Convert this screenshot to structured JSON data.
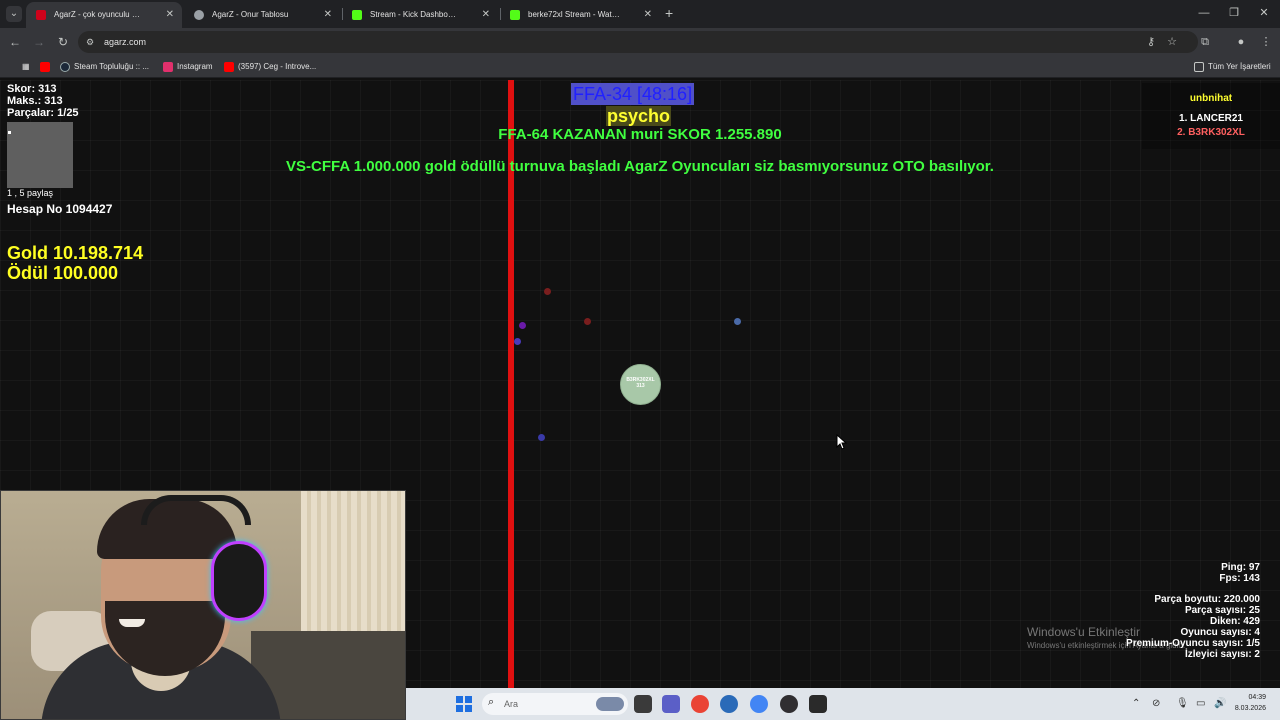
{
  "browser": {
    "tabs": [
      {
        "label": "AgarZ - çok oyunculu tarayıcı o",
        "active": true,
        "favicon_color": "#d0021b"
      },
      {
        "label": "AgarZ - Onur Tablosu",
        "active": false,
        "favicon_color": "#9aa0a6"
      },
      {
        "label": "Stream - Kick Dashboard",
        "active": false,
        "favicon_color": "#53fc18"
      },
      {
        "label": "berke72xl Stream - Watch Live o",
        "active": false,
        "favicon_color": "#53fc18"
      }
    ],
    "new_tab": "+",
    "url": "agarz.com",
    "bookmarks": [
      {
        "label": "Steam Topluluğu :: ...",
        "favicon_color": "#1b2838"
      },
      {
        "label": "Instagram",
        "favicon_color": "#e1306c"
      },
      {
        "label": "(3597) Ceg - Introve...",
        "favicon_color": "#ff0000"
      }
    ],
    "all_bookmarks": "Tüm Yer İşaretleri"
  },
  "game": {
    "stats": {
      "score": "Skor: 313",
      "max": "Maks.: 313",
      "pieces": "Parçalar: 1/25"
    },
    "share": "1 , 5 paylaş",
    "account": "Hesap No 1094427",
    "gold": "Gold 10.198.714",
    "reward": "Ödül 100.000",
    "server": "FFA-34 [48:16]",
    "top_player": "psycho",
    "winner_msg": "FFA-64 KAZANAN muri SKOR 1.255.890",
    "announcement": "VS-CFFA 1.000.000 gold ödüllü turnuva başladı AgarZ Oyuncuları siz basmıyorsunuz OTO basılıyor.",
    "leaderboard": {
      "title": "unbnihat",
      "rows": [
        "1. LANCER21",
        "2. B3RK302XL"
      ]
    },
    "cell": {
      "name": "B3RK302XL",
      "mass": "313",
      "color": "#a8c8a8"
    },
    "food": [
      {
        "color": "#7a1e1e"
      },
      {
        "color": "#6a1aa8"
      },
      {
        "color": "#7a1e1e"
      },
      {
        "color": "#4a6aa8"
      },
      {
        "color": "#4a3ab8"
      },
      {
        "color": "#3a3aa8"
      }
    ],
    "border_color": "#e01010",
    "net": {
      "ping": "Ping: 97",
      "fps": "Fps: 143"
    },
    "server_stats": {
      "piece_size": "Parça boyutu: 220.000",
      "piece_count": "Parça sayısı: 25",
      "spikes": "Diken: 429",
      "players": "Oyuncu sayısı: 4",
      "premium": "Premium-Oyuncu sayısı: 1/5",
      "viewers": "İzleyici sayısı: 2"
    }
  },
  "windows": {
    "activate_title": "Windows'u Etkinleştir",
    "activate_sub": "Windows'u etkinleştirmek için Ayarlar'a gidin.",
    "search_placeholder": "Ara",
    "time": "04:39",
    "date": "8.03.2026"
  }
}
